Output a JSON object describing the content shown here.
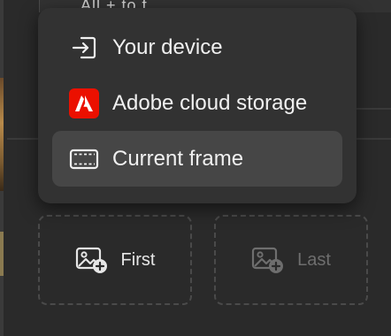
{
  "background": {
    "panel_text": "All + to f"
  },
  "menu": {
    "items": [
      {
        "label": "Your device",
        "icon": "import-icon"
      },
      {
        "label": "Adobe cloud storage",
        "icon": "adobe-logo-icon"
      },
      {
        "label": "Current frame",
        "icon": "film-frame-icon",
        "selected": true
      }
    ]
  },
  "frames": {
    "first_label": "First",
    "last_label": "Last",
    "icon": "add-image-icon"
  },
  "colors": {
    "adobe_red": "#eb1000",
    "menu_bg": "#323232",
    "selected_bg": "#464646",
    "page_bg": "#2a2a2a"
  }
}
